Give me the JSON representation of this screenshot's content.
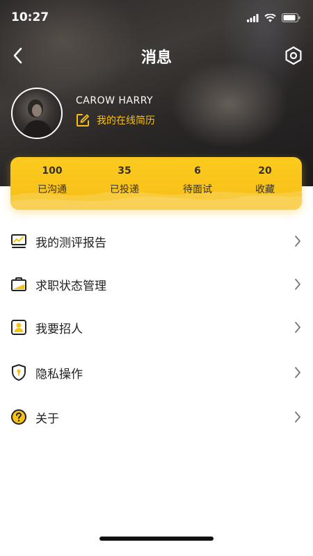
{
  "status_bar": {
    "time": "10:27"
  },
  "nav": {
    "title": "消息"
  },
  "profile": {
    "name": "CAROW  HARRY",
    "resume_link": "我的在线简历"
  },
  "stats": [
    {
      "value": "100",
      "label": "已沟通"
    },
    {
      "value": "35",
      "label": "已投递"
    },
    {
      "value": "6",
      "label": "待面试"
    },
    {
      "value": "20",
      "label": "收藏"
    }
  ],
  "menu": [
    {
      "label": "我的测评报告",
      "icon": "chart-monitor-icon"
    },
    {
      "label": "求职状态管理",
      "icon": "briefcase-icon"
    },
    {
      "label": "我要招人",
      "icon": "recruit-person-icon"
    },
    {
      "label": "隐私操作",
      "icon": "shield-lock-icon"
    },
    {
      "label": "关于",
      "icon": "question-circle-icon"
    }
  ],
  "colors": {
    "accent": "#f6c21a",
    "text": "#222222",
    "stats_bg": "#fccb1e"
  }
}
